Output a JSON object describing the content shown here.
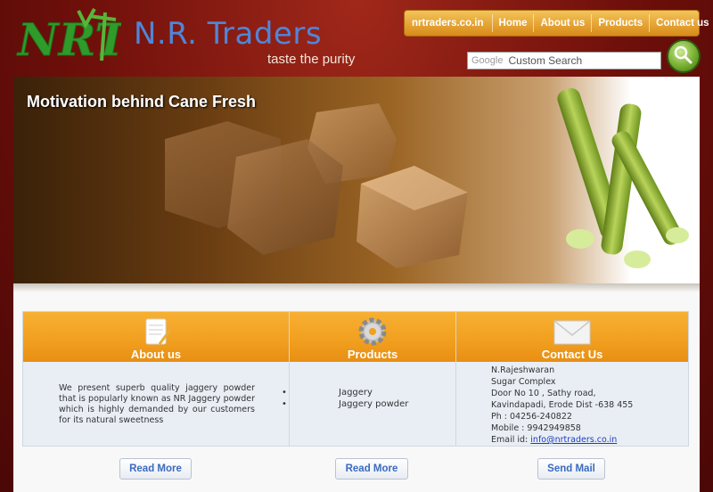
{
  "header": {
    "logo_text": "NRT",
    "brand": "N.R. Traders",
    "tagline": "taste the purity"
  },
  "nav": {
    "items": [
      {
        "label": "nrtraders.co.in"
      },
      {
        "label": "Home"
      },
      {
        "label": "About us"
      },
      {
        "label": "Products"
      },
      {
        "label": "Contact us"
      }
    ]
  },
  "search": {
    "provider_label": "Google",
    "placeholder": "Custom Search",
    "button_icon": "search-icon"
  },
  "banner": {
    "title": "Motivation behind Cane Fresh"
  },
  "sections": {
    "about": {
      "title": "About us",
      "icon": "notepad-pencil-icon",
      "text": "We present superb quality jaggery powder that is popularly known as NR Jaggery powder which is highly demanded by our customers for its natural sweetness",
      "button": "Read More"
    },
    "products": {
      "title": "Products",
      "icon": "gear-icon",
      "items": [
        "Jaggery",
        "Jaggery powder"
      ],
      "button": "Read More"
    },
    "contact": {
      "title": "Contact Us",
      "icon": "envelope-icon",
      "lines": [
        "N.Rajeshwaran",
        "Sugar Complex",
        "Door No 10 , Sathy road,",
        "Kavindapadi, Erode Dist -638 455",
        "Ph : 04256-240822",
        "Mobile : 9942949858"
      ],
      "email_label": "Email id: ",
      "email": "info@nrtraders.co.in",
      "button": "Send Mail"
    }
  },
  "colors": {
    "background": "#6e0f0a",
    "nav_orange": "#f0a42e",
    "panel_orange": "#f2a020",
    "brand_blue": "#4f86d8",
    "link_blue": "#3a6bbf"
  }
}
